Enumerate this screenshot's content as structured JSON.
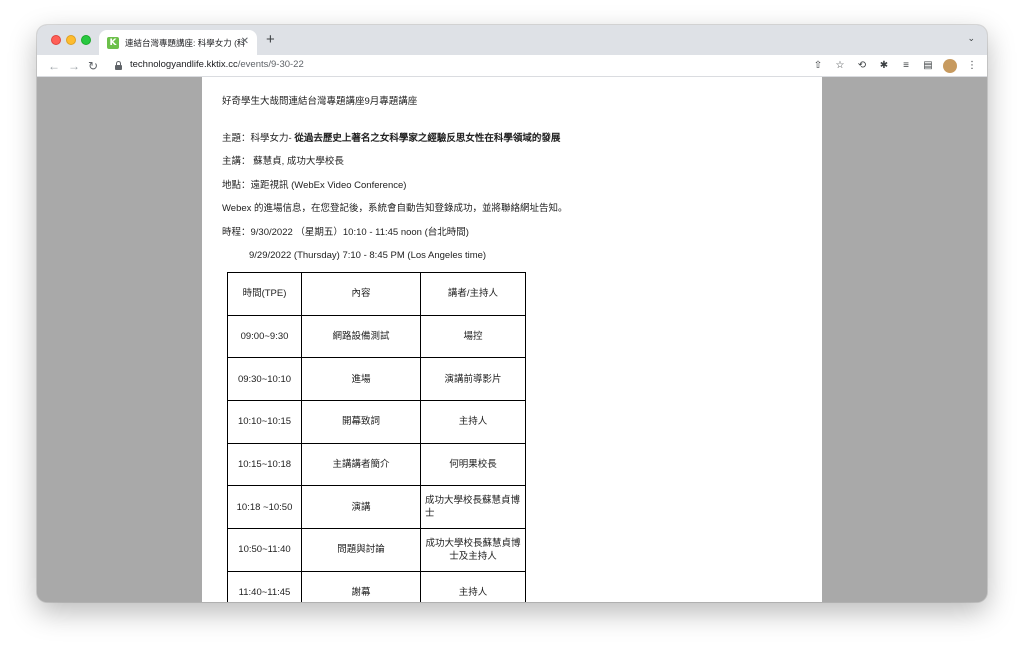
{
  "browser": {
    "tab_title": "連結台灣專題講座: 科學女力 (科",
    "favicon_letter": "K",
    "url_domain": "technologyandlife.kktix.cc",
    "url_path": "/events/9-30-22",
    "close_glyph": "✕",
    "newtab_glyph": "+",
    "tab_menu_glyph": "⌄",
    "back_glyph": "←",
    "forward_glyph": "→",
    "reload_glyph": "↻",
    "share_glyph": "⇧",
    "bookmark_glyph": "☆",
    "sync_glyph": "⟲",
    "extensions_glyph": "✱",
    "media_glyph": "≡",
    "sidepanel_glyph": "▤",
    "menu_glyph": "⋮"
  },
  "content": {
    "heading": "好奇學生大哉問連結台灣專題講座9月專題講座",
    "topic_label": "主題：科學女力- ",
    "topic_title": "從過去歷史上著名之女科學家之經驗反思女性在科學領域的發展",
    "speaker": "主講： 蘇慧貞, 成功大學校長",
    "location": "地點：遠距視訊 (WebEx Video Conference)",
    "webex_info": "Webex 的進場信息，在您登記後，系統會自動告知登錄成功，並將聯絡網址告知。",
    "time_taipei": "時程：9/30/2022 （星期五）10:10 - 11:45 noon (台北時間)",
    "time_la": "9/29/2022 (Thursday) 7:10 - 8:45 PM (Los Angeles time)"
  },
  "schedule": {
    "headers": [
      "時間(TPE)",
      "內容",
      "講者/主持人"
    ],
    "rows": [
      [
        "09:00~9:30",
        "網路設備測試",
        "場控"
      ],
      [
        "09:30~10:10",
        "進場",
        "演講前導影片"
      ],
      [
        "10:10~10:15",
        "開幕致詞",
        "主持人"
      ],
      [
        "10:15~10:18",
        "主講講者簡介",
        "何明果校長"
      ],
      [
        "10:18 ~10:50",
        "演講",
        "成功大學校長蘇慧貞博士"
      ],
      [
        "10:50~11:40",
        "問題與討論",
        "成功大學校長蘇慧貞博士及主持人"
      ],
      [
        "11:40~11:45",
        "謝幕",
        "主持人"
      ]
    ]
  }
}
